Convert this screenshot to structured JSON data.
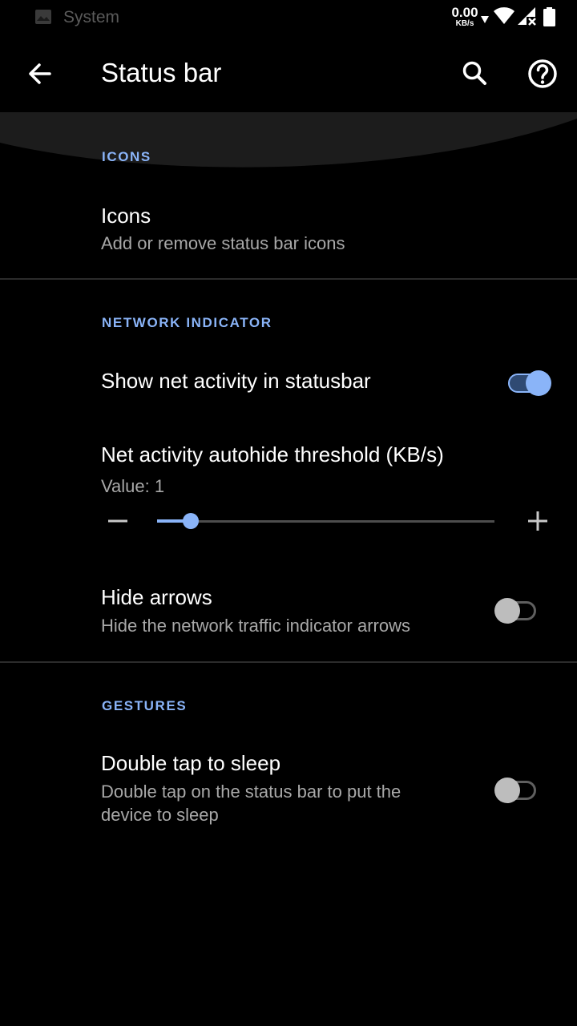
{
  "status_bar": {
    "app_name": "System",
    "net_speed": "0.00",
    "net_speed_unit": "KB/s",
    "icons": [
      "notification-icon",
      "download-arrow-icon",
      "wifi-icon",
      "signal-no-data-icon",
      "battery-icon"
    ]
  },
  "app_bar": {
    "title": "Status bar",
    "icons": [
      "back-arrow-icon",
      "search-icon",
      "help-icon"
    ]
  },
  "sections": {
    "icons": {
      "header": "ICONS",
      "item_title": "Icons",
      "item_summary": "Add or remove status bar icons"
    },
    "network": {
      "header": "NETWORK INDICATOR",
      "show_net_activity": {
        "title": "Show net activity in statusbar",
        "enabled": true
      },
      "threshold": {
        "title": "Net activity autohide threshold (KB/s)",
        "value_text": "Value: 1",
        "value": 1,
        "fill_fraction": 0.1
      },
      "hide_arrows": {
        "title": "Hide arrows",
        "summary": "Hide the network traffic indicator arrows",
        "enabled": false
      }
    },
    "gestures": {
      "header": "GESTURES",
      "double_tap": {
        "title": "Double tap to sleep",
        "summary": "Double tap on the status bar to put the device to sleep",
        "enabled": false
      }
    }
  },
  "colors": {
    "accent": "#8ab4f8",
    "background": "#000000",
    "summary_text": "#a8a8a8",
    "divider": "#2b2b2b"
  }
}
